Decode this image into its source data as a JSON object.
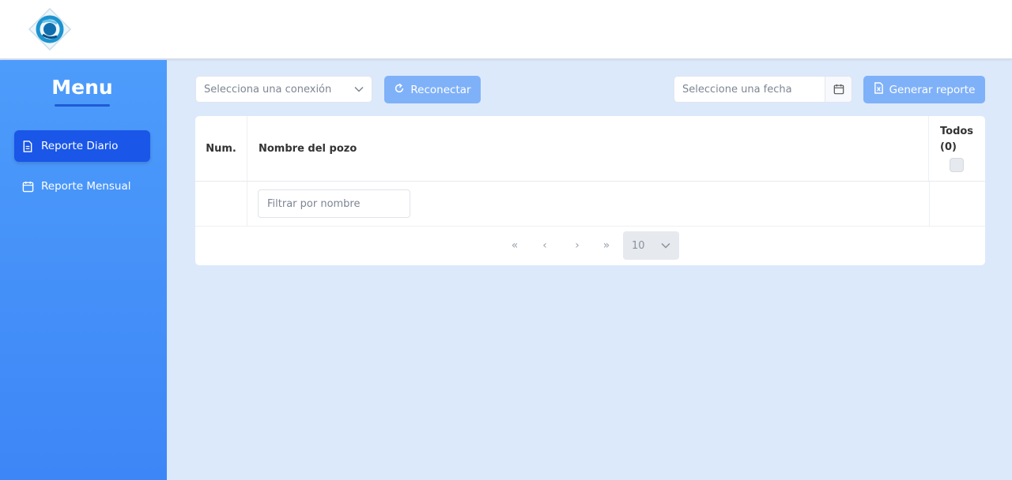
{
  "sidebar": {
    "title": "Menu",
    "items": [
      {
        "label": "Reporte Diario",
        "icon": "document-icon",
        "active": true
      },
      {
        "label": "Reporte Mensual",
        "icon": "calendar-icon",
        "active": false
      }
    ]
  },
  "toolbar": {
    "connection_placeholder": "Selecciona una conexión",
    "reconnect_label": "Reconectar",
    "date_placeholder": "Seleccione una fecha",
    "generate_label": "Generar reporte"
  },
  "table": {
    "col_num": "Num.",
    "col_name": "Nombre del pozo",
    "col_all_line1": "Todos",
    "col_all_line2": "(0)",
    "filter_placeholder": "Filtrar por nombre"
  },
  "pagination": {
    "first": "«",
    "prev": "‹",
    "next": "›",
    "last": "»",
    "page_size": "10"
  },
  "colors": {
    "sidebar": "#4d9cfb",
    "active_item": "#1a56e8",
    "button": "#7fb1f9",
    "background": "#dce9fb"
  }
}
